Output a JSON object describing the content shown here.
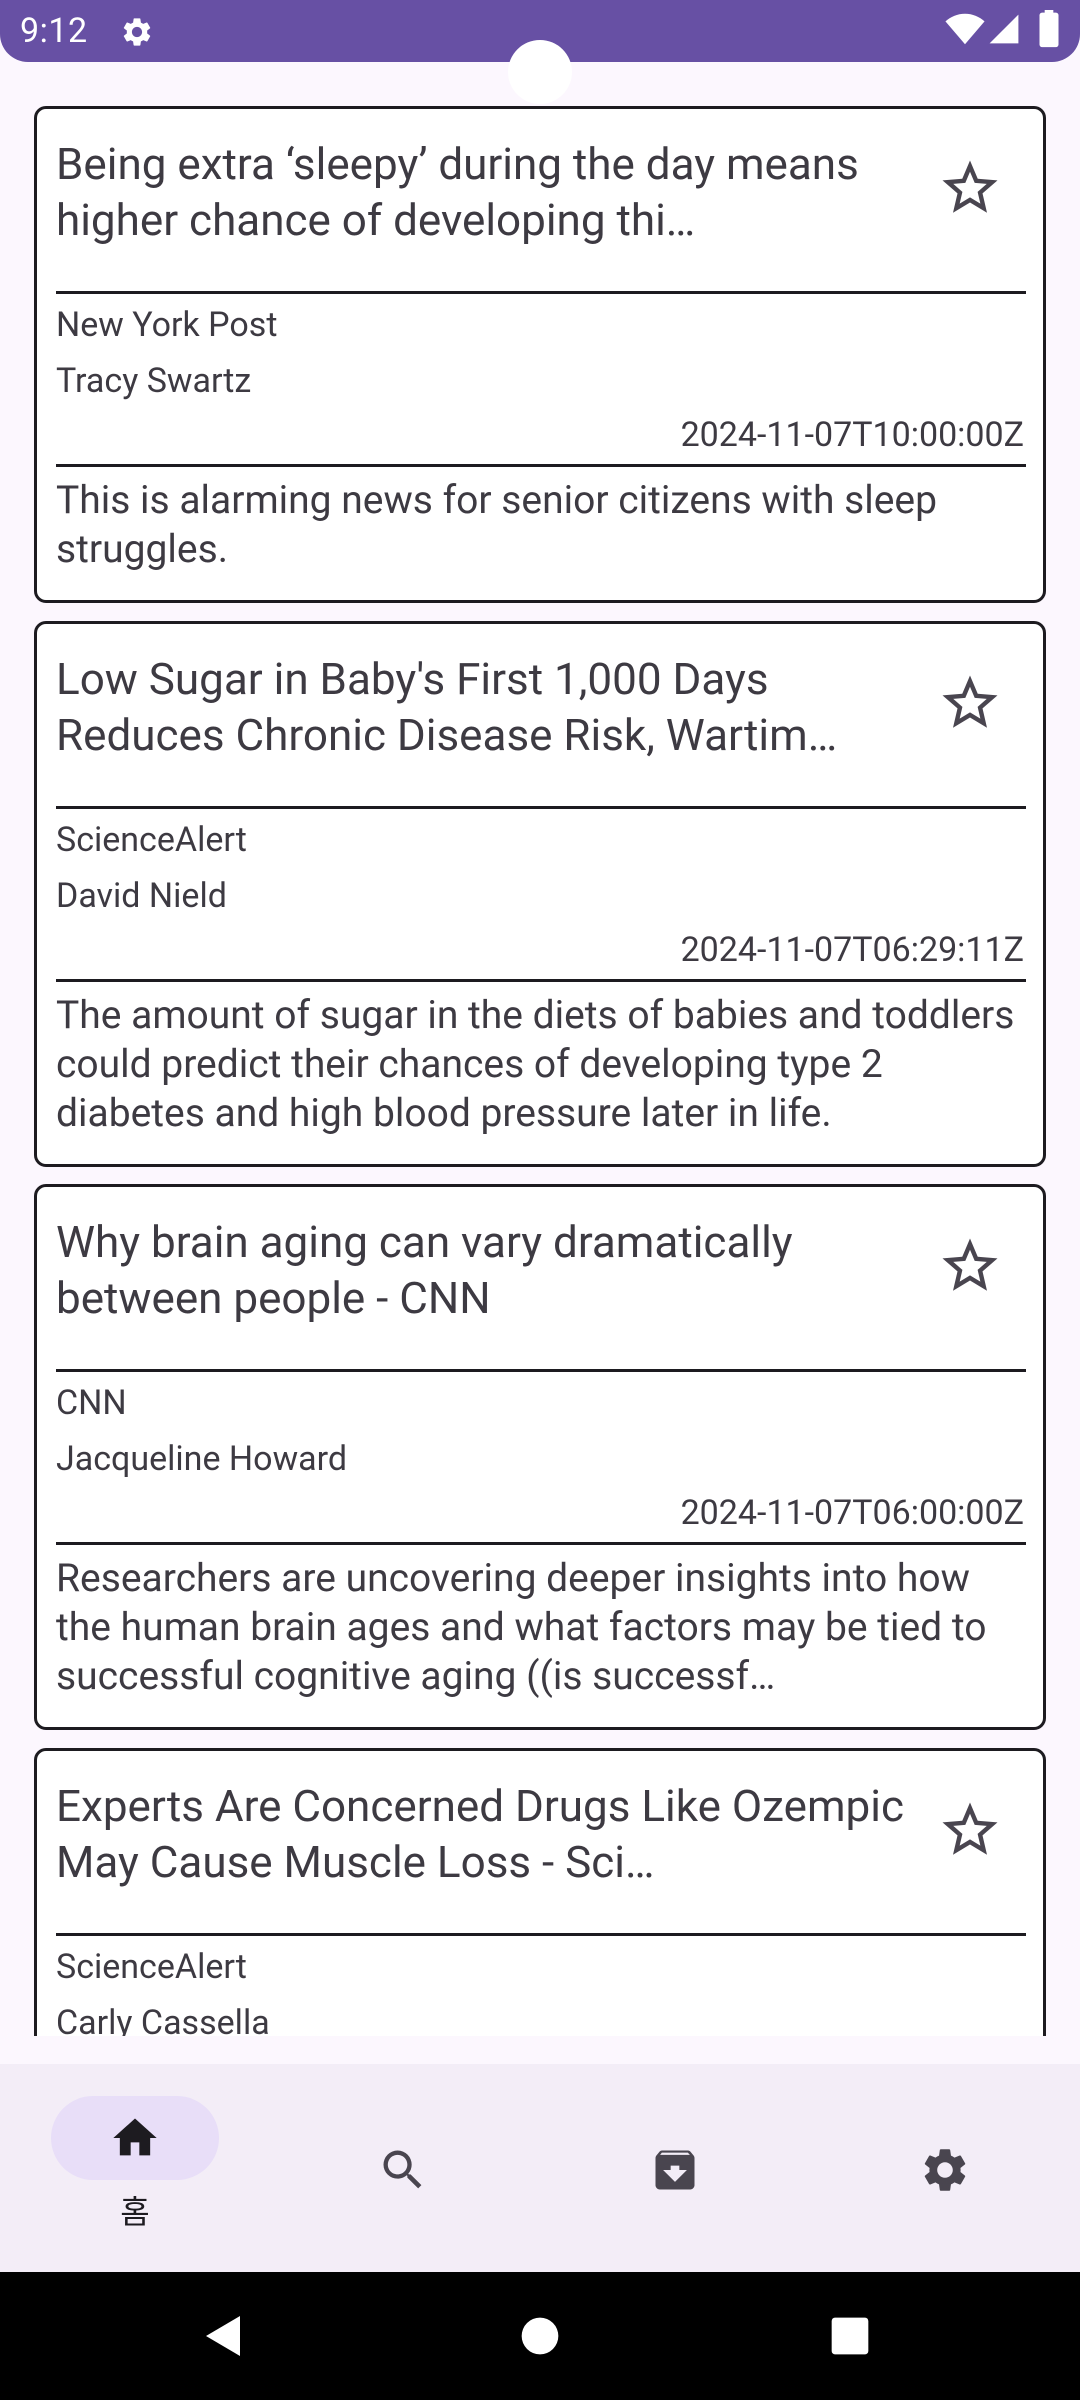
{
  "status_bar": {
    "time": "9:12",
    "icons": [
      "gear-icon",
      "wifi-icon",
      "signal-icon",
      "battery-icon"
    ]
  },
  "articles": [
    {
      "title": "Being extra ‘sleepy’ during the day means higher chance of developing thi…",
      "source": "New York Post",
      "author": "Tracy Swartz",
      "published_at": "2024-11-07T10:00:00Z",
      "description": "This is alarming news for senior citizens with sleep struggles."
    },
    {
      "title": "Low Sugar in Baby's First 1,000 Days Reduces Chronic Disease Risk, Wartim…",
      "source": "ScienceAlert",
      "author": "David Nield",
      "published_at": "2024-11-07T06:29:11Z",
      "description": "The amount of sugar in the diets of babies and toddlers could predict their chances of developing type 2 diabetes and high blood pressure later in life."
    },
    {
      "title": "Why brain aging can vary dramatically between people - CNN",
      "source": "CNN",
      "author": "Jacqueline Howard",
      "published_at": "2024-11-07T06:00:00Z",
      "description": "Researchers are uncovering deeper insights into how the human brain ages and what factors may be tied to successful cognitive aging ((is successf…"
    },
    {
      "title": "Experts Are Concerned Drugs Like Ozempic May Cause Muscle Loss - Sci…",
      "source": "ScienceAlert",
      "author": "Carly Cassella",
      "published_at": "",
      "description": ""
    }
  ],
  "bottom_nav": {
    "items": [
      {
        "icon": "home-icon",
        "label": "홈",
        "active": true
      },
      {
        "icon": "search-icon",
        "label": "",
        "active": false
      },
      {
        "icon": "archive-icon",
        "label": "",
        "active": false
      },
      {
        "icon": "settings-icon",
        "label": "",
        "active": false
      }
    ]
  },
  "colors": {
    "primary": "#6750a4",
    "nav_background": "#f3edf7",
    "nav_indicator": "#e8def8",
    "card_border": "#1d1b20",
    "text": "#3d3a42"
  }
}
